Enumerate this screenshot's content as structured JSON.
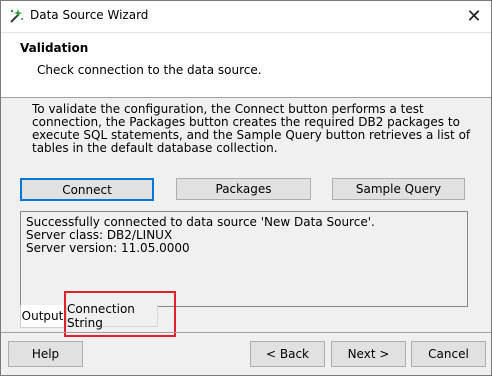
{
  "window": {
    "title": "Data Source Wizard",
    "title_icon": "wizard-wand-icon",
    "close_glyph": "✕"
  },
  "header": {
    "title": "Validation",
    "subtitle": "Check connection to the data source."
  },
  "description": "To validate the configuration, the Connect button performs a test connection, the Packages button creates the required DB2 packages to execute SQL statements, and the Sample Query button retrieves a list of tables in the default database collection.",
  "actions": {
    "connect": "Connect",
    "packages": "Packages",
    "sample_query": "Sample Query"
  },
  "output": {
    "lines": [
      "Successfully connected to data source 'New Data Source'.",
      "Server class: DB2/LINUX",
      "Server version: 11.05.0000"
    ]
  },
  "tabs": {
    "output": "Output",
    "connection_string": "Connection String"
  },
  "footer": {
    "help": "Help",
    "back": "< Back",
    "next": "Next >",
    "cancel": "Cancel"
  },
  "colors": {
    "highlight": "#e0202a",
    "default_border": "#0078d7"
  }
}
